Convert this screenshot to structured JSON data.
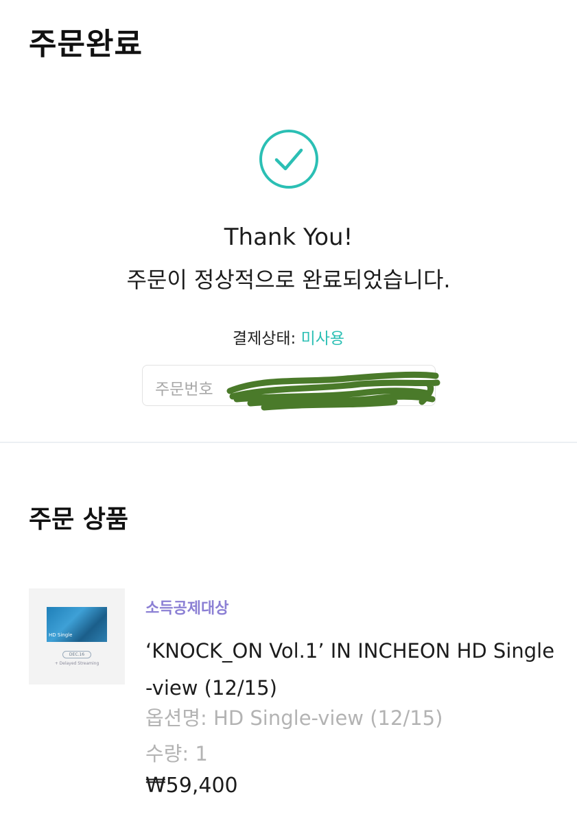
{
  "header": {
    "title": "주문완료"
  },
  "confirmation": {
    "thanks": "Thank You!",
    "message": "주문이 정상적으로 완료되었습니다.",
    "payment_status_label": "결제상태:",
    "payment_status_value": "미사용",
    "order_number_label": "주문번호"
  },
  "colors": {
    "accent": "#2bbfb4",
    "tag": "#8b7fd4",
    "redaction": "#4a7a2a"
  },
  "order_items": {
    "section_title": "주문 상품",
    "item": {
      "tag": "소득공제대상",
      "name": "‘KNOCK_ON Vol.1’ IN INCHEON HD Single-view (12/15)",
      "option_label": "옵션명:",
      "option_value": "HD Single-view (12/15)",
      "quantity_label": "수량:",
      "quantity_value": "1",
      "price": "₩59,400",
      "thumbnail": {
        "photo_caption": "HD Single",
        "pill_text": "DEC.16",
        "footer_text": "+ Delayed Streaming"
      }
    }
  }
}
